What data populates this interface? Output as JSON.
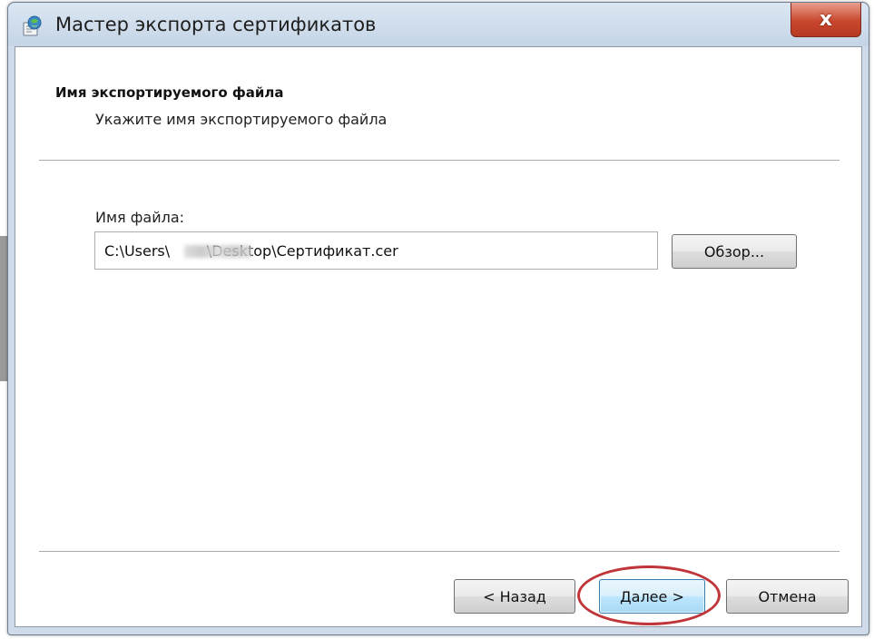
{
  "window": {
    "title": "Мастер экспорта сертификатов",
    "close_label": "x"
  },
  "header": {
    "title": "Имя экспортируемого файла",
    "subtitle": "Укажите имя экспортируемого файла"
  },
  "file": {
    "label": "Имя файла:",
    "value": "C:\\Users\\        \\Desktop\\Сертификат.cer"
  },
  "buttons": {
    "browse": "Обзор...",
    "back": "< Назад",
    "next": "Далее >",
    "cancel": "Отмена"
  },
  "icons": {
    "app": "certificate-wizard-icon",
    "close": "close-icon"
  },
  "colors": {
    "close_button": "#c9462d",
    "highlight_ring": "#c0353a",
    "default_button_border": "#3c7fb1",
    "titlebar": "#cfdbe8"
  }
}
